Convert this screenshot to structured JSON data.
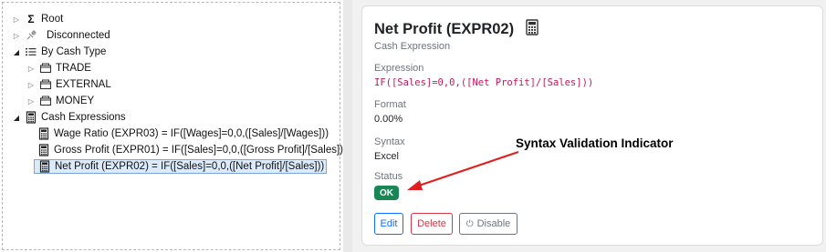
{
  "tree": {
    "items": [
      {
        "label": "Root",
        "icon": "sigma-icon"
      },
      {
        "label": "Disconnected",
        "icon": "unplug-icon"
      },
      {
        "label": "By Cash Type",
        "icon": "list-icon"
      },
      {
        "label": "TRADE",
        "icon": "folder-icon"
      },
      {
        "label": "EXTERNAL",
        "icon": "folder-icon"
      },
      {
        "label": "MONEY",
        "icon": "folder-icon"
      },
      {
        "label": "Cash Expressions",
        "icon": "calculator-icon"
      },
      {
        "label": "Wage Ratio (EXPR03) = IF([Wages]=0,0,([Sales]/[Wages]))",
        "icon": "calculator-icon"
      },
      {
        "label": "Gross Profit (EXPR01) = IF([Sales]=0,0,([Gross Profit]/[Sales]))",
        "icon": "calculator-icon"
      },
      {
        "label": "Net Profit (EXPR02) = IF([Sales]=0,0,([Net Profit]/[Sales]))",
        "icon": "calculator-icon",
        "selected": true
      }
    ]
  },
  "detail": {
    "title": "Net Profit (EXPR02)",
    "subtitle": "Cash Expression",
    "expression_label": "Expression",
    "expression_value": "IF([Sales]=0,0,([Net Profit]/[Sales]))",
    "format_label": "Format",
    "format_value": "0.00%",
    "syntax_label": "Syntax",
    "syntax_value": "Excel",
    "status_label": "Status",
    "status_value": "OK",
    "buttons": {
      "edit": "Edit",
      "delete": "Delete",
      "disable": "Disable"
    }
  },
  "annotation": {
    "text": "Syntax Validation Indicator"
  },
  "colors": {
    "ok_badge": "#198754",
    "edit": "#0d6efd",
    "delete": "#dc3545",
    "disable": "#6c757d",
    "selection": "#dcebfb",
    "arrow": "#e02020"
  }
}
